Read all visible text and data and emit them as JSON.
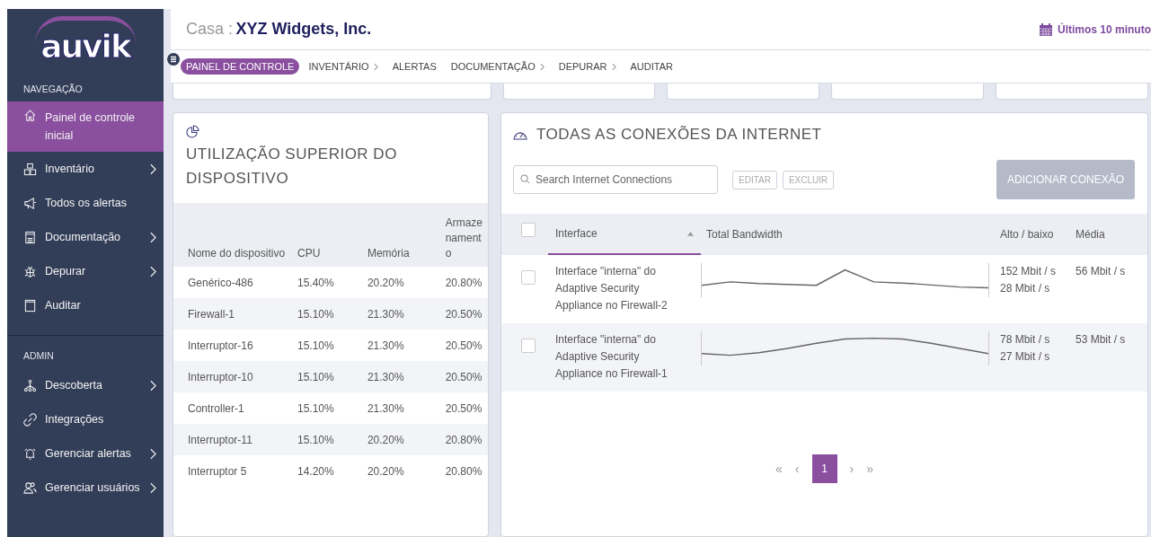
{
  "sidebar": {
    "logo": "auvik",
    "sections": [
      {
        "heading": "NAVEGAÇÃO",
        "items": [
          {
            "label": "Painel de controle inicial",
            "kind": "home",
            "selected": true,
            "submenu": false
          },
          {
            "label": "Inventário",
            "kind": "boxes",
            "selected": false,
            "submenu": true
          },
          {
            "label": "Todos os alertas",
            "kind": "megaphone",
            "selected": false,
            "submenu": false
          },
          {
            "label": "Documentação",
            "kind": "document",
            "selected": false,
            "submenu": true
          },
          {
            "label": "Depurar",
            "kind": "bug",
            "selected": false,
            "submenu": true
          },
          {
            "label": "Auditar",
            "kind": "clipboard",
            "selected": false,
            "submenu": false
          }
        ]
      },
      {
        "heading": "ADMIN",
        "items": [
          {
            "label": "Descoberta",
            "kind": "network",
            "selected": false,
            "submenu": true
          },
          {
            "label": "Integrações",
            "kind": "link",
            "selected": false,
            "submenu": false
          },
          {
            "label": "Gerenciar alertas",
            "kind": "bell",
            "selected": false,
            "submenu": true
          },
          {
            "label": "Gerenciar usuários",
            "kind": "users",
            "selected": false,
            "submenu": true
          }
        ]
      }
    ]
  },
  "header": {
    "prefix": "Casa :",
    "title": "XYZ Widgets, Inc.",
    "time_range": "Últimos 10 minuto"
  },
  "nav_tabs": [
    {
      "label": "PAINEL DE CONTROLE",
      "selected": true,
      "submenu": false
    },
    {
      "label": "INVENTÁRIO",
      "selected": false,
      "submenu": true
    },
    {
      "label": "ALERTAS",
      "selected": false,
      "submenu": false
    },
    {
      "label": "DOCUMENTAÇÃO",
      "selected": false,
      "submenu": true
    },
    {
      "label": "DEPURAR",
      "selected": false,
      "submenu": true
    },
    {
      "label": "AUDITAR",
      "selected": false,
      "submenu": false
    }
  ],
  "device_panel": {
    "title": "UTILIZAÇÃO SUPERIOR DO DISPOSITIVO",
    "columns": [
      "Nome do dispositivo",
      "CPU",
      "Memória",
      "Armaze nament o"
    ],
    "rows": [
      [
        "Genérico-486",
        "15.40%",
        "20.20%",
        "20.80%"
      ],
      [
        "Firewall-1",
        "15.10%",
        "21.30%",
        "20.50%"
      ],
      [
        "Interruptor-16",
        "15.10%",
        "21.30%",
        "20.50%"
      ],
      [
        "Interruptor-10",
        "15.10%",
        "21.30%",
        "20.50%"
      ],
      [
        "Controller-1",
        "15.10%",
        "21.30%",
        "20.50%"
      ],
      [
        "Interruptor-11",
        "15.10%",
        "20.20%",
        "20.80%"
      ],
      [
        "Interruptor 5",
        "14.20%",
        "20.20%",
        "20.80%"
      ]
    ]
  },
  "connections_panel": {
    "title": "TODAS AS CONEXÕES DA INTERNET",
    "search": {
      "placeholder": "Search Internet Connections"
    },
    "buttons": [
      {
        "label": "EDITAR",
        "disabled": true
      },
      {
        "label": "EXCLUIR",
        "disabled": true
      }
    ],
    "add_button": {
      "label": "ADICIONAR CONEXÃO",
      "disabled": true
    },
    "columns": [
      {
        "label": "Interface",
        "sorted": true
      },
      {
        "label": "Total Bandwidth",
        "sorted": false
      },
      {
        "label": "Alto / baixo",
        "sorted": false
      },
      {
        "label": "Média",
        "sorted": false
      }
    ],
    "header_checked": false,
    "rows": [
      {
        "interface": "Interface \"interna\" do Adaptive Security Appliance no Firewall-2",
        "high": "152 Mbit / s",
        "low": "28 Mbit / s",
        "average": "56 Mbit / s",
        "checked": false
      },
      {
        "interface": "Interface \"interna\" do Adaptive Security Appliance no Firewall-1",
        "high": "78 Mbit / s",
        "low": "27 Mbit / s",
        "average": "53 Mbit / s",
        "checked": false
      }
    ],
    "pagination": {
      "first": "«",
      "prev": "‹",
      "pages": [
        {
          "label": "1",
          "selected": true
        }
      ],
      "next": "›",
      "last": "»"
    }
  }
}
